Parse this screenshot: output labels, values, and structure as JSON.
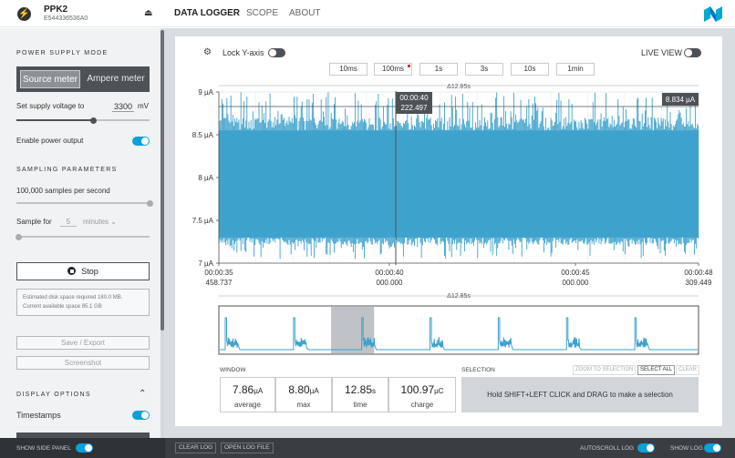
{
  "header": {
    "device_name": "PPK2",
    "device_serial": "E544336536A0",
    "nav": [
      "DATA LOGGER",
      "SCOPE",
      "ABOUT"
    ]
  },
  "sidebar": {
    "power_supply_title": "POWER SUPPLY MODE",
    "mode_source": "Source meter",
    "mode_ampere": "Ampere meter",
    "supply_voltage_label": "Set supply voltage to",
    "supply_voltage_value": "3300",
    "supply_voltage_unit": "mV",
    "supply_voltage_fraction": 0.58,
    "enable_power_label": "Enable power output",
    "enable_power_on": true,
    "sampling_title": "SAMPLING PARAMETERS",
    "samples_label": "100,000 samples per second",
    "samples_fraction": 1.0,
    "sample_for_label": "Sample for",
    "sample_for_value": "5",
    "sample_for_unit": "minutes",
    "stop_label": "Stop",
    "disk_line1": "Estimated disk space required 180.0 MB.",
    "disk_line2": "Current available space 85.1 GB",
    "save_export_label": "Save / Export",
    "screenshot_label": "Screenshot",
    "display_title": "DISPLAY OPTIONS",
    "timestamps_label": "Timestamps",
    "timestamps_on": true
  },
  "toolbar": {
    "lock_y_label": "Lock Y-axis",
    "lock_y_on": false,
    "live_view_label": "LIVE VIEW",
    "live_view_on": false,
    "zoom_buttons": [
      "10ms",
      "100ms",
      "1s",
      "3s",
      "10s",
      "1min"
    ]
  },
  "chart_data": {
    "type": "area",
    "delta_label": "Δ12.85s",
    "y_ticks": [
      "9 µA",
      "8.5 µA",
      "8 µA",
      "7.5 µA",
      "7 µA"
    ],
    "ylim": [
      7,
      9
    ],
    "band": {
      "low": 7.3,
      "high": 8.55,
      "spike_low": 7.05,
      "spike_high": 9.0
    },
    "x_ticks": [
      {
        "time": "00:00:35",
        "sub": "458.737"
      },
      {
        "time": "00:00:40",
        "sub": "000.000"
      },
      {
        "time": "00:00:45",
        "sub": "000.000"
      },
      {
        "time": "00:00:48",
        "sub": "309.449"
      }
    ],
    "cursor": {
      "time": "00:00:40",
      "value": "222.497"
    },
    "value_label": "8.834 µA",
    "color": "#3ea2cc"
  },
  "minimap": {
    "delta_label": "Δ12.85s",
    "pulses": 7,
    "window_fraction": [
      0.233,
      0.323
    ]
  },
  "window_stats": {
    "title": "WINDOW",
    "average": {
      "value": "7.86",
      "unit": "µA",
      "label": "average"
    },
    "max": {
      "value": "8.80",
      "unit": "µA",
      "label": "max"
    },
    "time": {
      "value": "12.85",
      "unit": "s",
      "label": "time"
    },
    "charge": {
      "value": "100.97",
      "unit": "µC",
      "label": "charge"
    }
  },
  "selection": {
    "title": "SELECTION",
    "zoom_to_selection": "ZOOM TO SELECTION",
    "select_all": "SELECT ALL",
    "clear": "CLEAR",
    "hint": "Hold SHIFT+LEFT CLICK and DRAG to make a selection"
  },
  "footer": {
    "show_side_panel": "SHOW SIDE PANEL",
    "show_side_panel_on": true,
    "clear_log": "CLEAR LOG",
    "open_log_file": "OPEN LOG FILE",
    "autoscroll_log": "AUTOSCROLL LOG",
    "autoscroll_on": true,
    "show_log": "SHOW LOG",
    "show_log_on": true
  }
}
